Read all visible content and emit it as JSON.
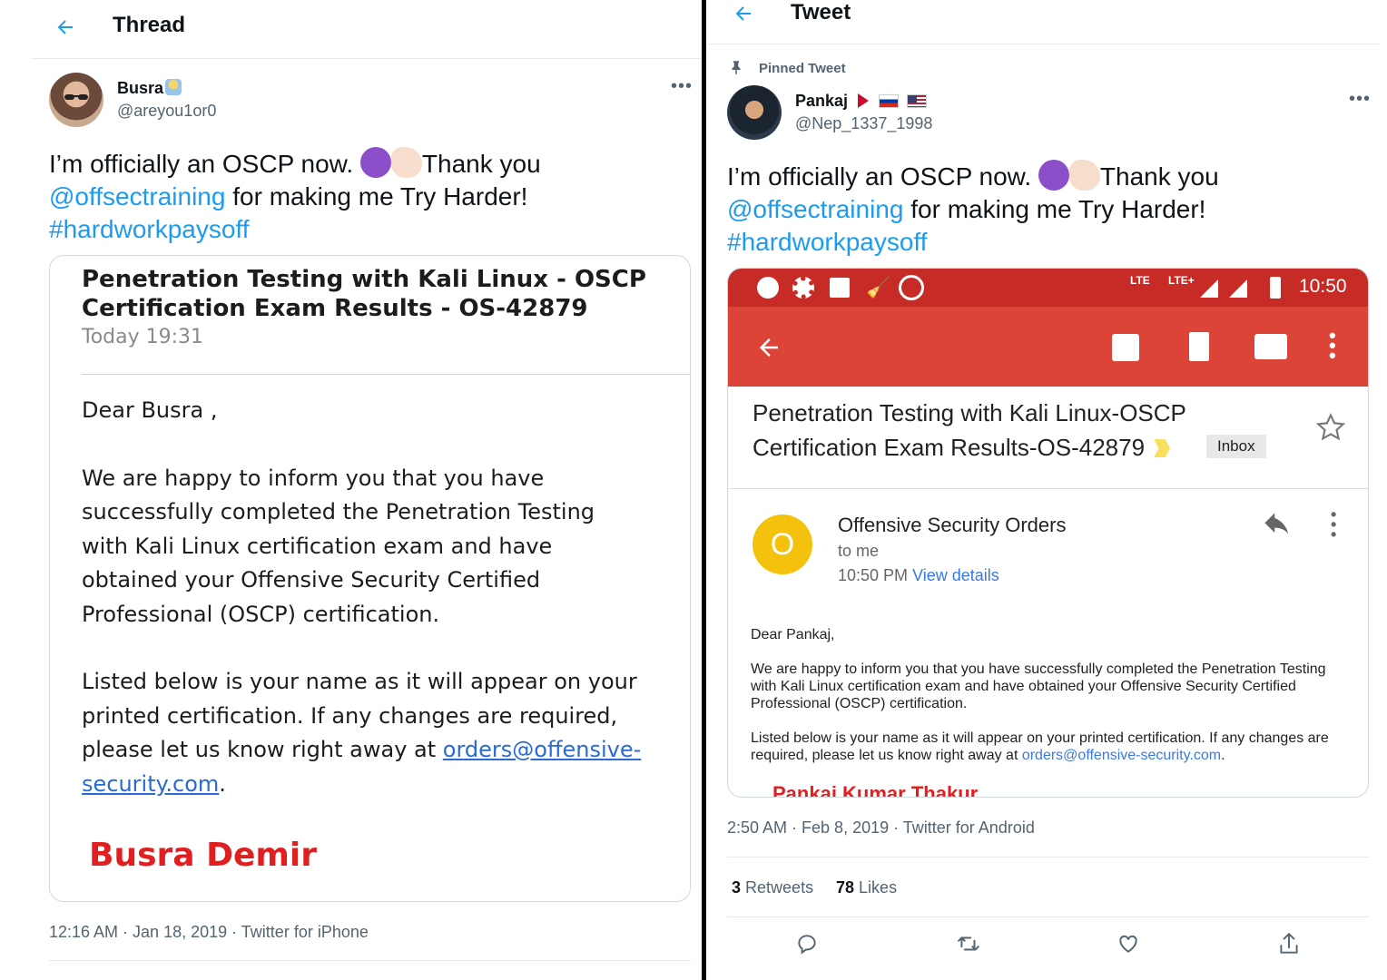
{
  "left": {
    "header_title": "Thread",
    "author_name": "Busra",
    "author_handle": "@areyou1or0",
    "text_line1_a": "I’m officially an OSCP now. ",
    "text_line1_b": "Thank you",
    "mention": "@offsectraining",
    "text_line2_rest": " for making me Try Harder!",
    "hashtag": "#hardworkpaysoff",
    "email": {
      "subject_line1": "Penetration Testing with Kali Linux - OSCP",
      "subject_line2": "Certification Exam Results - OS-42879",
      "date": "Today 19:31",
      "greeting": "Dear Busra ,",
      "para1_l1": "We are happy to inform you that you have",
      "para1_l2": "successfully completed the Penetration Testing",
      "para1_l3": "with Kali Linux certification exam and have",
      "para1_l4": "obtained your Offensive Security Certified",
      "para1_l5": "Professional (OSCP) certification.",
      "para2_l1": "Listed below is your name as it will appear on your",
      "para2_l2": "printed certification. If any changes are required,",
      "para2_l3": "please let us know right away at ",
      "link_part1": "orders@offensive-",
      "link_part2": "security.com",
      "period": ".",
      "cert_name": "Busra Demir"
    },
    "timestamp": "12:16 AM · Jan 18, 2019 · Twitter for iPhone"
  },
  "right": {
    "header_title": "Tweet",
    "pinned_label": "Pinned Tweet",
    "author_name": "Pankaj",
    "author_handle": "@Nep_1337_1998",
    "text_line1_a": "I’m officially an OSCP now. ",
    "text_line1_b": "Thank you",
    "mention": "@offsectraining",
    "text_line2_rest": " for making me Try Harder!",
    "hashtag": "#hardworkpaysoff",
    "email": {
      "status_time": "10:50",
      "status_lte1": "LTE",
      "status_lte2": "LTE+",
      "subject_line1": "Penetration Testing with Kali Linux-OSCP",
      "subject_line2": "Certification Exam Results-OS-42879",
      "label_chip": "Inbox",
      "sender_initial": "O",
      "sender_name": "Offensive Security Orders",
      "recipient": "to me",
      "time": "10:50 PM",
      "view_details": "View details",
      "greeting": "Dear Pankaj,",
      "para1_l1": "We are happy to inform you that you have successfully completed the Penetration Testing",
      "para1_l2": "with Kali Linux certification exam and have obtained your Offensive Security Certified",
      "para1_l3": "Professional (OSCP) certification.",
      "para2_l1": "Listed below is your name as it will appear on your printed certification. If any changes are",
      "para2_l2": "required, please let us know right away at ",
      "link": "orders@offensive-security.com",
      "period": ".",
      "cert_name": "Pankaj Kumar Thakur"
    },
    "timestamp": "2:50 AM · Feb 8, 2019 · Twitter for Android",
    "retweets_count": "3",
    "retweets_label": "Retweets",
    "likes_count": "78",
    "likes_label": "Likes"
  },
  "colors": {
    "accent": "#1d9bf0",
    "gmail_red": "#db4437",
    "cert_red": "#e02020",
    "sender_avatar": "#f4c20d"
  }
}
